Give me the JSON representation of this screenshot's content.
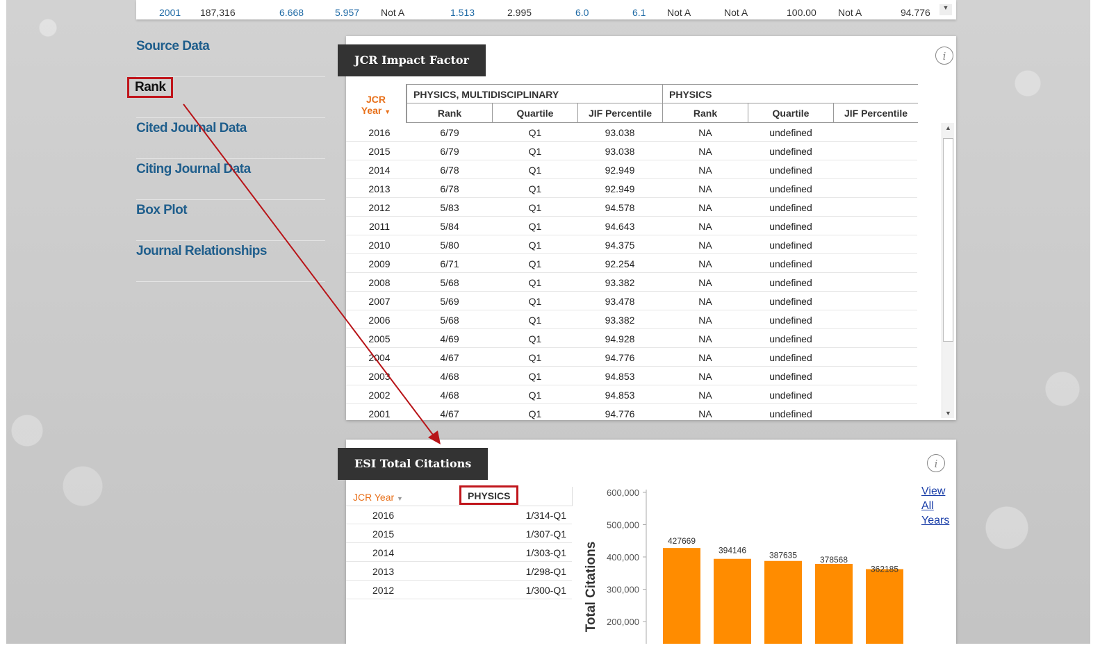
{
  "top_row": {
    "cells": [
      {
        "text": "2001",
        "blue": true
      },
      {
        "text": "187,316",
        "blue": false
      },
      {
        "text": "6.668",
        "blue": true
      },
      {
        "text": "5.957",
        "blue": true
      },
      {
        "text": "Not A",
        "blue": false
      },
      {
        "text": "1.513",
        "blue": true
      },
      {
        "text": "2.995",
        "blue": false
      },
      {
        "text": "6.0",
        "blue": true
      },
      {
        "text": "6.1",
        "blue": true
      },
      {
        "text": "Not A",
        "blue": false
      },
      {
        "text": "Not A",
        "blue": false
      },
      {
        "text": "100.00",
        "blue": false
      },
      {
        "text": "Not A",
        "blue": false
      },
      {
        "text": "94.776",
        "blue": false
      }
    ]
  },
  "nav": {
    "items": [
      {
        "label": "Source Data",
        "active": false
      },
      {
        "label": "Rank",
        "active": true
      },
      {
        "label": "Cited Journal Data",
        "active": false
      },
      {
        "label": "Citing Journal Data",
        "active": false
      },
      {
        "label": "Box Plot",
        "active": false
      },
      {
        "label": "Journal Relationships",
        "active": false
      }
    ]
  },
  "jcr_panel": {
    "title": "JCR Impact Factor",
    "info_glyph": "i",
    "year_header_line1": "JCR",
    "year_header_line2": "Year",
    "group1": "PHYSICS, MULTIDISCIPLINARY",
    "group2": "PHYSICS",
    "sub_headers": [
      "Rank",
      "Quartile",
      "JIF Percentile",
      "Rank",
      "Quartile",
      "JIF Percentile"
    ],
    "rows": [
      [
        "2016",
        "6/79",
        "Q1",
        "93.038",
        "NA",
        "undefined",
        ""
      ],
      [
        "2015",
        "6/79",
        "Q1",
        "93.038",
        "NA",
        "undefined",
        ""
      ],
      [
        "2014",
        "6/78",
        "Q1",
        "92.949",
        "NA",
        "undefined",
        ""
      ],
      [
        "2013",
        "6/78",
        "Q1",
        "92.949",
        "NA",
        "undefined",
        ""
      ],
      [
        "2012",
        "5/83",
        "Q1",
        "94.578",
        "NA",
        "undefined",
        ""
      ],
      [
        "2011",
        "5/84",
        "Q1",
        "94.643",
        "NA",
        "undefined",
        ""
      ],
      [
        "2010",
        "5/80",
        "Q1",
        "94.375",
        "NA",
        "undefined",
        ""
      ],
      [
        "2009",
        "6/71",
        "Q1",
        "92.254",
        "NA",
        "undefined",
        ""
      ],
      [
        "2008",
        "5/68",
        "Q1",
        "93.382",
        "NA",
        "undefined",
        ""
      ],
      [
        "2007",
        "5/69",
        "Q1",
        "93.478",
        "NA",
        "undefined",
        ""
      ],
      [
        "2006",
        "5/68",
        "Q1",
        "93.382",
        "NA",
        "undefined",
        ""
      ],
      [
        "2005",
        "4/69",
        "Q1",
        "94.928",
        "NA",
        "undefined",
        ""
      ],
      [
        "2004",
        "4/67",
        "Q1",
        "94.776",
        "NA",
        "undefined",
        ""
      ],
      [
        "2003",
        "4/68",
        "Q1",
        "94.853",
        "NA",
        "undefined",
        ""
      ],
      [
        "2002",
        "4/68",
        "Q1",
        "94.853",
        "NA",
        "undefined",
        ""
      ],
      [
        "2001",
        "4/67",
        "Q1",
        "94.776",
        "NA",
        "undefined",
        ""
      ]
    ]
  },
  "esi_panel": {
    "title": "ESI Total Citations",
    "info_glyph": "i",
    "year_header": "JCR Year",
    "physics_header": "PHYSICS",
    "rows": [
      [
        "2016",
        "1/314-Q1"
      ],
      [
        "2015",
        "1/307-Q1"
      ],
      [
        "2014",
        "1/303-Q1"
      ],
      [
        "2013",
        "1/298-Q1"
      ],
      [
        "2012",
        "1/300-Q1"
      ]
    ],
    "view_all_link": [
      "View",
      "All",
      "Years"
    ]
  },
  "chart_data": {
    "type": "bar",
    "ylabel": "Total Citations",
    "yticks": [
      "600,000",
      "500,000",
      "400,000",
      "300,000",
      "200,000"
    ],
    "ylim": [
      200000,
      600000
    ],
    "values": [
      427669,
      394146,
      387635,
      378568,
      362185
    ],
    "value_labels": [
      "427669",
      "394146",
      "387635",
      "378568",
      "362185"
    ],
    "bar_color": "#ff8c00"
  },
  "colors": {
    "accent_orange": "#e8701a",
    "highlight_red": "#c0151b",
    "nav_blue": "#1f5e8c",
    "tab_dark": "#333333"
  }
}
